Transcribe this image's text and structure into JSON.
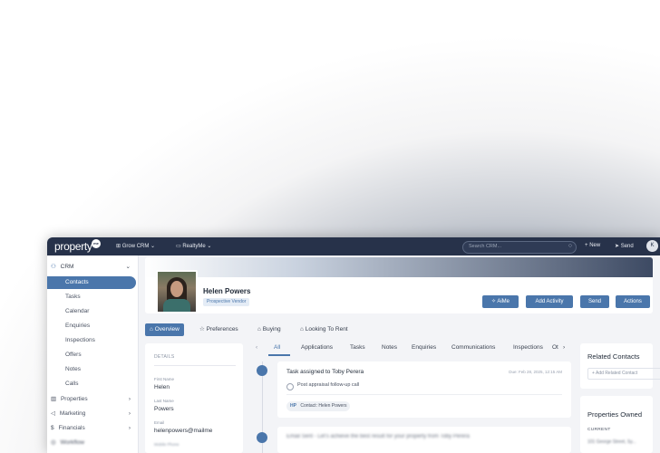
{
  "topbar": {
    "logo": "property",
    "logo_badge": "me",
    "grow_crm": "Grow CRM",
    "realtyme": "RealtyMe",
    "search_placeholder": "Search CRM...",
    "new_label": "New",
    "send_label": "Send",
    "avatar_initial": "K"
  },
  "sidebar": {
    "crm": "CRM",
    "items": [
      "Contacts",
      "Tasks",
      "Calendar",
      "Enquiries",
      "Inspections",
      "Offers",
      "Notes",
      "Calls"
    ],
    "sections": [
      "Properties",
      "Marketing",
      "Financials",
      "Workflow"
    ]
  },
  "profile": {
    "name": "Helen Powers",
    "badge": "Prospective Vendor",
    "buttons": [
      "AiMe",
      "Add Activity",
      "Send",
      "Actions"
    ]
  },
  "profile_tabs": [
    "Overview",
    "Preferences",
    "Buying",
    "Looking To Rent"
  ],
  "details": {
    "title": "DETAILS",
    "fields": [
      {
        "label": "First Name",
        "value": "Helen"
      },
      {
        "label": "Last Name",
        "value": "Powers"
      },
      {
        "label": "Email",
        "value": "helenpowers@mailme"
      },
      {
        "label": "Mobile Phone",
        "value": ""
      }
    ]
  },
  "activity_tabs": [
    "All",
    "Applications",
    "Tasks",
    "Notes",
    "Enquiries",
    "Communications",
    "Inspections",
    "Ot"
  ],
  "task": {
    "title": "Task assigned to Toby Perera",
    "date": "Due: Feb 28, 2025, 12:15 AM",
    "subtask": "Post appraisal follow-up call",
    "chip_tag": "HP",
    "chip_text": "Contact: Helen Powers"
  },
  "email_preview": "Email Sent - Let's achieve the best result for your property from Toby Perera",
  "related": {
    "title": "Related Contacts",
    "add_button": "+ Add Related Contact"
  },
  "owned": {
    "title": "Properties Owned",
    "current_label": "CURRENT",
    "property": "101 George Street, Sy..."
  }
}
